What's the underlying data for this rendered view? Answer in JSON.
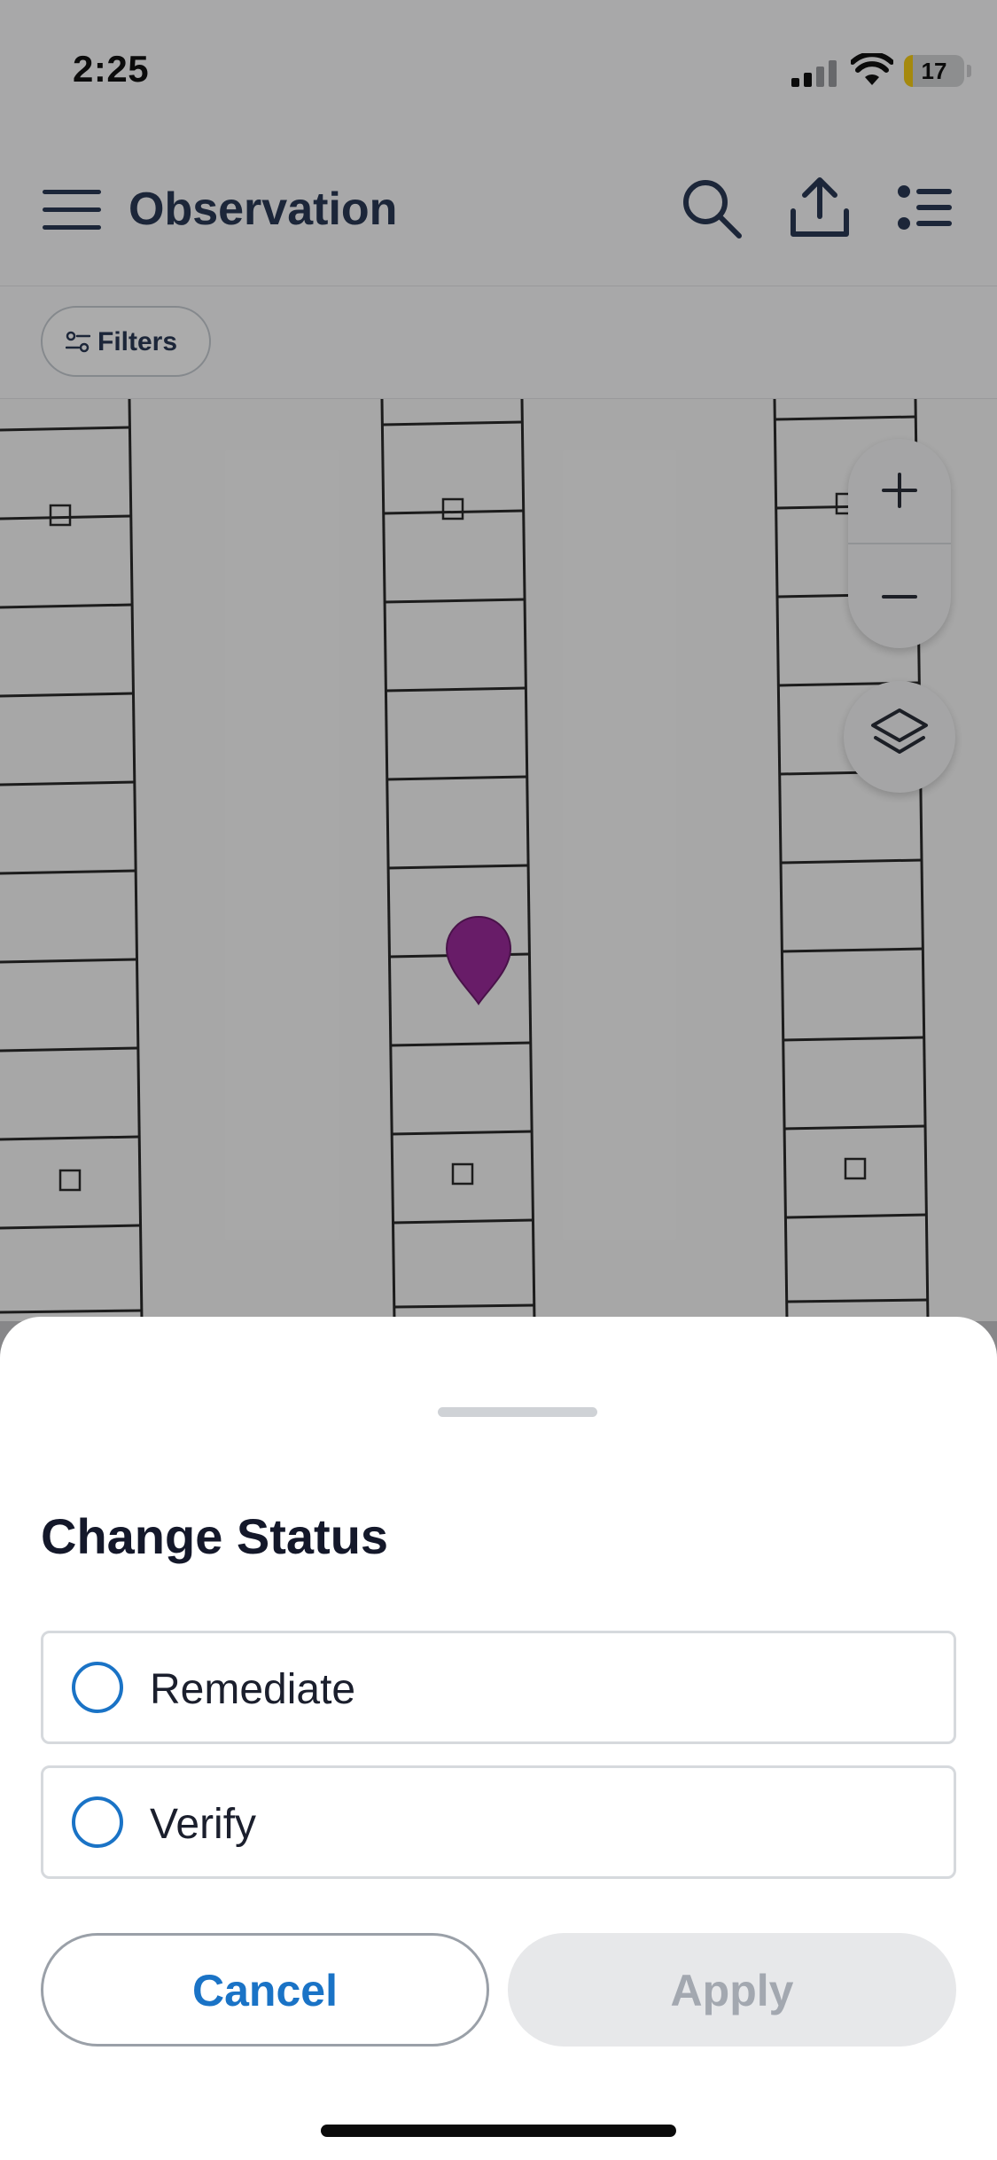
{
  "status_bar": {
    "time": "2:25",
    "battery": "17"
  },
  "header": {
    "title": "Observation",
    "icons": [
      "menu-icon",
      "search-icon",
      "share-icon",
      "list-icon"
    ]
  },
  "filters": {
    "label": "Filters",
    "icon": "sliders-icon"
  },
  "map": {
    "zoom_in_symbol": "+",
    "zoom_out_symbol": "−",
    "pin_color": "#9b2a9c",
    "controls": [
      "zoom-in",
      "zoom-out",
      "layers"
    ]
  },
  "sheet": {
    "title": "Change Status",
    "options": [
      {
        "label": "Remediate",
        "selected": false
      },
      {
        "label": "Verify",
        "selected": false
      }
    ],
    "cancel_label": "Cancel",
    "apply_label": "Apply",
    "apply_enabled": false
  },
  "colors": {
    "accent": "#1a73c6",
    "title_text": "#14182a",
    "header_text": "#2b3a55",
    "disabled_bg": "#e7e8ea",
    "disabled_text": "#a3a8b0"
  }
}
